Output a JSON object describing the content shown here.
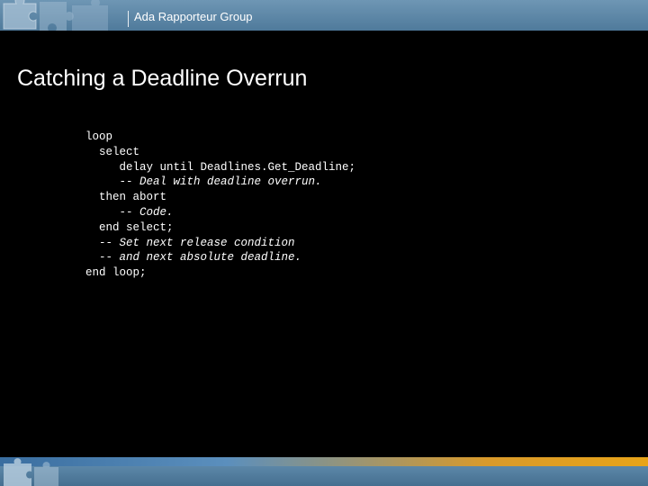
{
  "header": {
    "group_name": "Ada Rapporteur Group"
  },
  "slide": {
    "title": "Catching a Deadline Overrun"
  },
  "code": {
    "lines": [
      {
        "text": "loop",
        "comment": false
      },
      {
        "text": "  select",
        "comment": false
      },
      {
        "text": "     delay until Deadlines.Get_Deadline;",
        "comment": false
      },
      {
        "text": "     -- Deal with deadline overrun.",
        "comment": true
      },
      {
        "text": "  then abort",
        "comment": false
      },
      {
        "text": "     -- Code.",
        "comment": true
      },
      {
        "text": "  end select;",
        "comment": false
      },
      {
        "text": "  -- Set next release condition",
        "comment": true
      },
      {
        "text": "  -- and next absolute deadline.",
        "comment": true
      },
      {
        "text": "end loop;",
        "comment": false
      }
    ]
  },
  "colors": {
    "background": "#000000",
    "header": "#5a84a4",
    "accent_orange": "#e8a418"
  },
  "icons": {
    "header_logo": "puzzle-pieces-logo",
    "footer_logo": "puzzle-pieces-logo"
  }
}
